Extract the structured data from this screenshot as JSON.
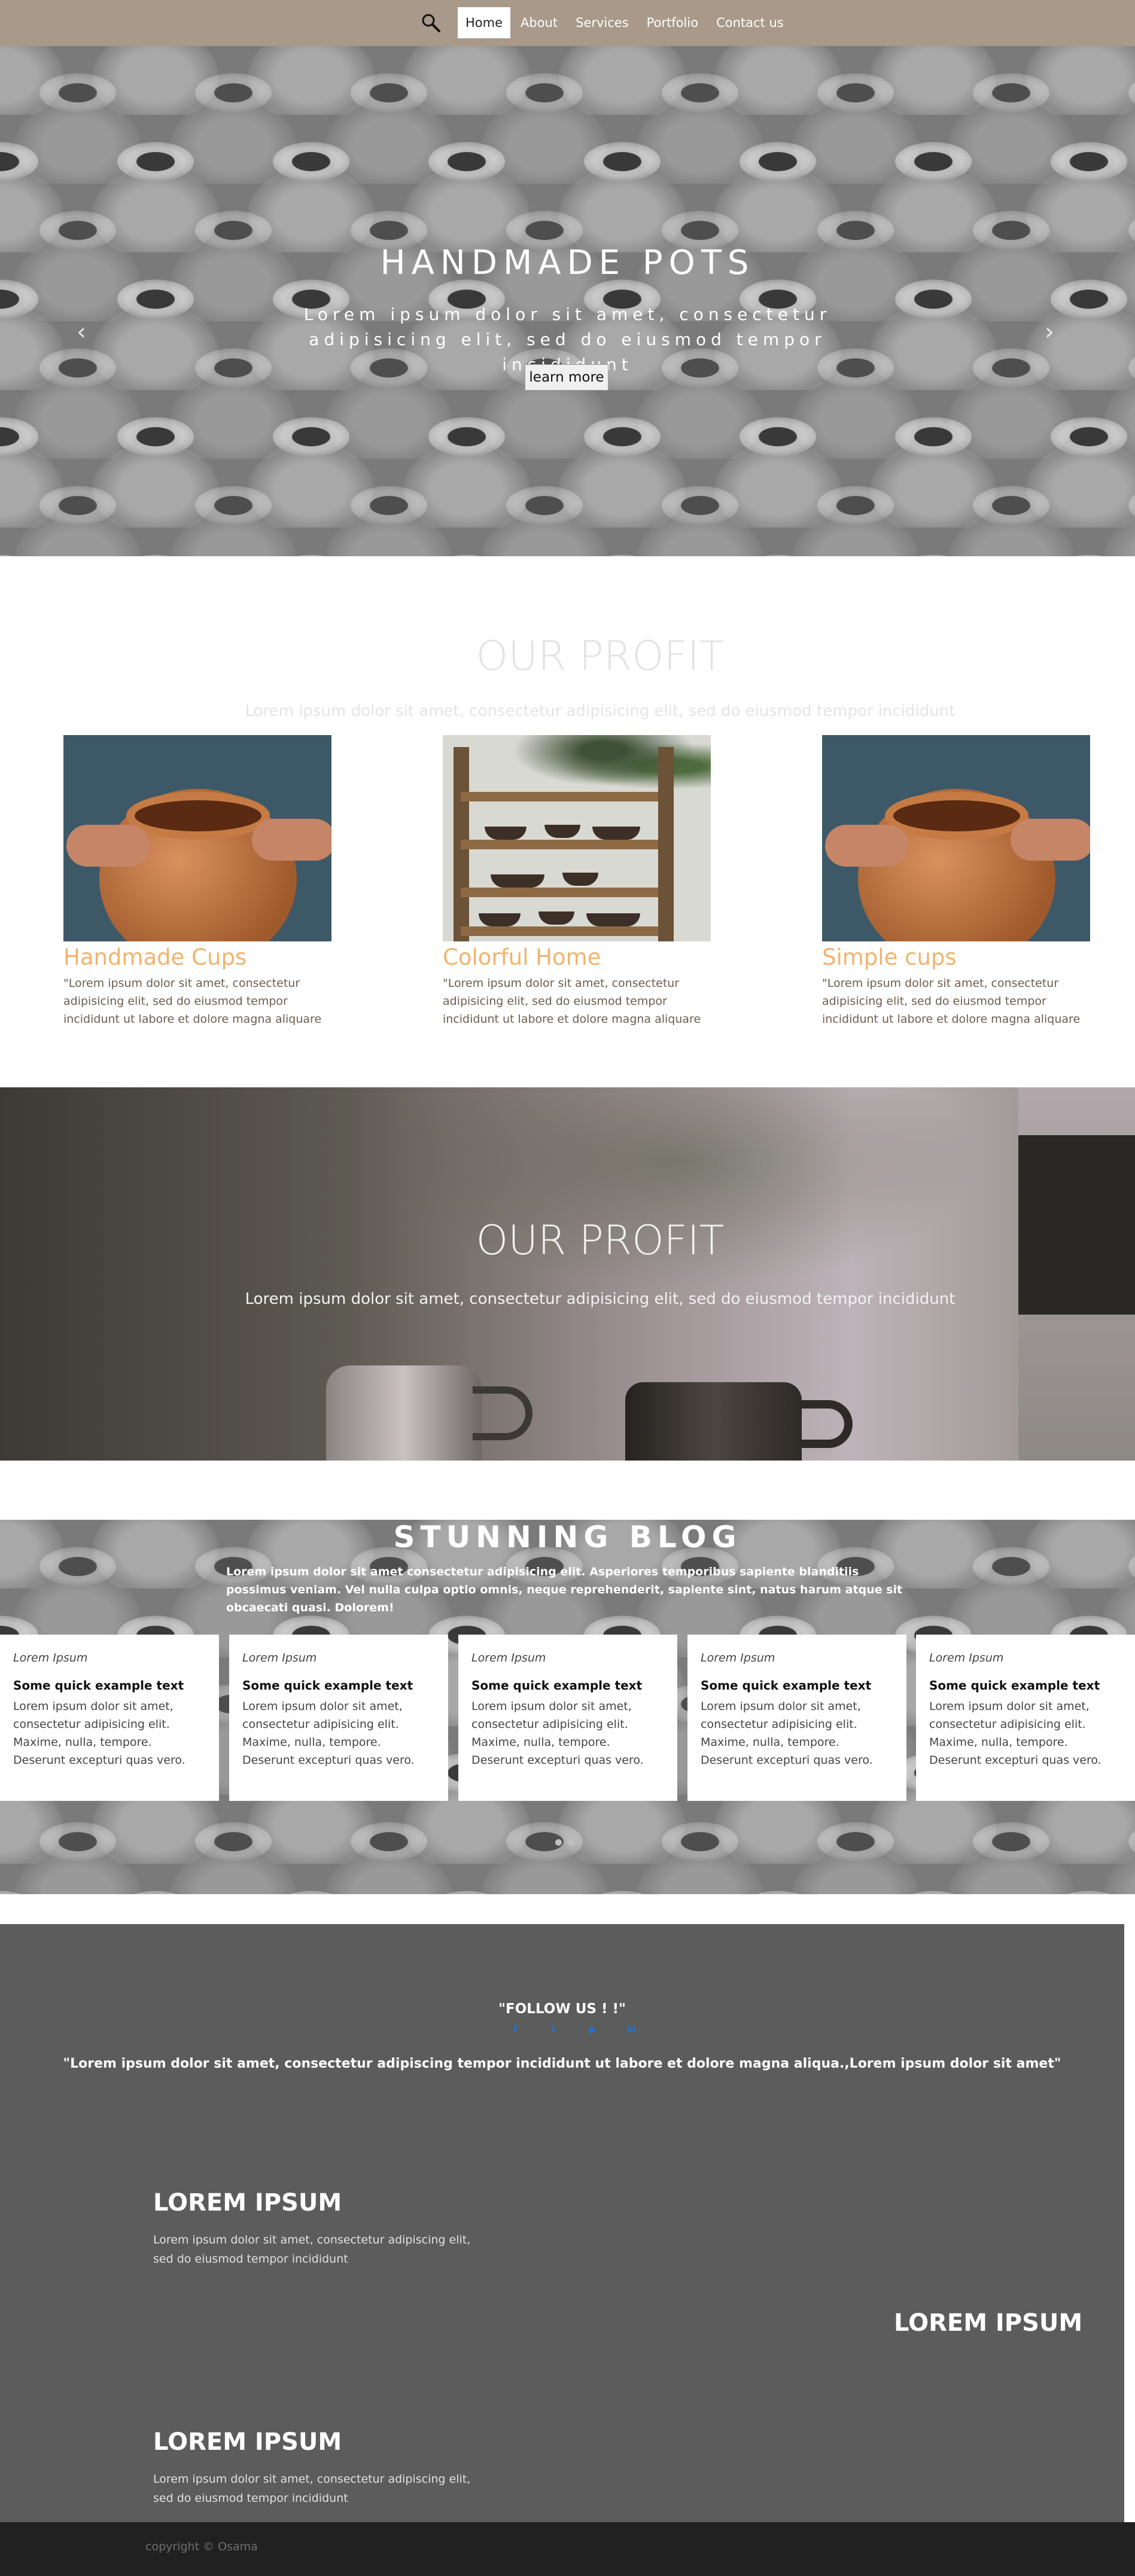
{
  "nav": {
    "items": [
      "Home",
      "About",
      "Services",
      "Portfolio",
      "Contact us"
    ],
    "active": "Home",
    "search_icon": "search-icon"
  },
  "hero": {
    "title": "HANDMADE POTS",
    "subtitle": "Lorem ipsum dolor sit amet, consectetur adipisicing elit, sed do eiusmod tempor incididunt",
    "button": "learn more",
    "prev_icon": "chevron-left-icon",
    "next_icon": "chevron-right-icon"
  },
  "profit": {
    "title": "OUR PROFIT",
    "subtitle": "Lorem ipsum dolor sit amet, consectetur adipisicing elit, sed do eiusmod tempor incididunt",
    "cards": [
      {
        "name": "Handmade Cups",
        "text": "\"Lorem ipsum dolor sit amet, consectetur adipisicing elit, sed do eiusmod tempor incididunt ut labore et dolore magna aliquare"
      },
      {
        "name": "Colorful Home",
        "text": "\"Lorem ipsum dolor sit amet, consectetur adipisicing elit, sed do eiusmod tempor incididunt ut labore et dolore magna aliquare"
      },
      {
        "name": "Simple cups",
        "text": "\"Lorem ipsum dolor sit amet, consectetur adipisicing elit, sed do eiusmod tempor incididunt ut labore et dolore magna aliquare"
      }
    ]
  },
  "banner": {
    "title": "OUR PROFIT",
    "subtitle": "Lorem ipsum dolor sit amet, consectetur adipisicing elit, sed do eiusmod tempor incididunt"
  },
  "blog": {
    "title": "STUNNING BLOG",
    "subtitle": "Lorem ipsum dolor sit amet consectetur adipisicing elit. Asperiores temporibus sapiente blanditiis possimus veniam. Vel nulla culpa optio omnis, neque reprehenderit, sapiente sint, natus harum atque sit obcaecati quasi. Dolorem!",
    "cards": [
      {
        "meta": "Lorem Ipsum",
        "head": "Some quick example text",
        "body": "Lorem ipsum dolor sit amet, consectetur adipisicing elit. Maxime, nulla, tempore. Deserunt excepturi quas vero."
      },
      {
        "meta": "Lorem Ipsum",
        "head": "Some quick example text",
        "body": "Lorem ipsum dolor sit amet, consectetur adipisicing elit. Maxime, nulla, tempore. Deserunt excepturi quas vero."
      },
      {
        "meta": "Lorem Ipsum",
        "head": "Some quick example text",
        "body": "Lorem ipsum dolor sit amet, consectetur adipisicing elit. Maxime, nulla, tempore. Deserunt excepturi quas vero."
      },
      {
        "meta": "Lorem Ipsum",
        "head": "Some quick example text",
        "body": "Lorem ipsum dolor sit amet, consectetur adipisicing elit. Maxime, nulla, tempore. Deserunt excepturi quas vero."
      },
      {
        "meta": "Lorem Ipsum",
        "head": "Some quick example text",
        "body": "Lorem ipsum dolor sit amet, consectetur adipisicing elit. Maxime, nulla, tempore. Deserunt excepturi quas vero."
      }
    ]
  },
  "footer": {
    "follow": "\"FOLLOW US ! !\"",
    "social": [
      "facebook-icon",
      "twitter-icon",
      "youtube-icon",
      "linkedin-icon"
    ],
    "quote": "\"Lorem ipsum dolor sit amet, consectetur adipiscing tempor incididunt ut labore et dolore magna aliqua.,Lorem ipsum dolor sit amet\"",
    "blocks": [
      {
        "head": "LOREM IPSUM",
        "text": "Lorem ipsum dolor sit amet, consectetur adipiscing elit, sed do eiusmod tempor incididunt"
      },
      {
        "head": "LOREM IPSUM"
      },
      {
        "head": "LOREM IPSUM",
        "text": "Lorem ipsum dolor sit amet, consectetur adipiscing elit, sed do eiusmod tempor incididunt"
      }
    ],
    "copyright": "copyright © Osama"
  },
  "colors": {
    "nav": "#a8998a",
    "accent": "#f2b36e",
    "footer": "#5c5c5c",
    "copyright_bar": "#212121",
    "social": "#1a73e8"
  }
}
